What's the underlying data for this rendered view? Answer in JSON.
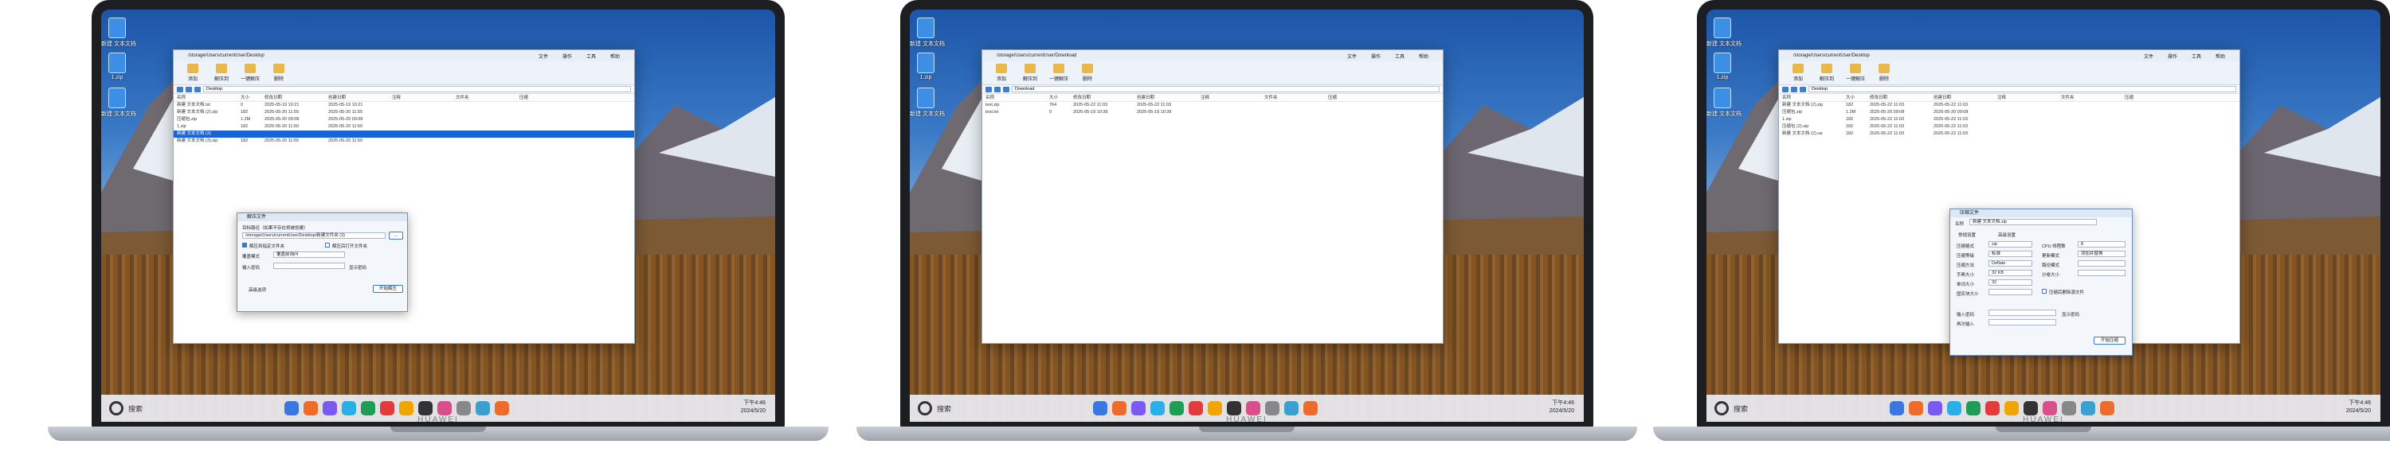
{
  "brand": "HUAWEI",
  "taskbar": {
    "search_label": "搜索",
    "time": "下午4:46",
    "date": "2024/5/20"
  },
  "desktop_icons": [
    {
      "label": "新建 文本文档"
    },
    {
      "label": "1.zip"
    },
    {
      "label": "新建 文本文档"
    }
  ],
  "ribbon": [
    "添加",
    "解压到",
    "一键解压",
    "删除"
  ],
  "menu": [
    "文件",
    "操作",
    "工具",
    "帮助"
  ],
  "columns": [
    "名称",
    "大小",
    "修改日期",
    "创建日期",
    "注释",
    "文件夹",
    "压缩"
  ],
  "screen1": {
    "path": "/storage/Users/currentUser/Desktop",
    "addr": "Desktop",
    "rows": [
      {
        "name": "新建 文本文档.txt",
        "size": "0",
        "mod": "2025-05-19 10:21",
        "cre": "2025-05-19 10:21"
      },
      {
        "name": "新建 文本文档 (2).zip",
        "size": "182",
        "mod": "2025-05-20 11:50",
        "cre": "2025-05-20 11:50"
      },
      {
        "name": "压缩包.zip",
        "size": "1.2M",
        "mod": "2025-05-20 09:08",
        "cre": "2025-05-20 09:08"
      },
      {
        "name": "1.zip",
        "size": "182",
        "mod": "2025-05-20 11:50",
        "cre": "2025-05-20 11:50"
      },
      {
        "name": "新建 文本文档 (3)",
        "size": "",
        "mod": "",
        "cre": "",
        "sel": true
      },
      {
        "name": "新建 文本文档 (3).zip",
        "size": "182",
        "mod": "2025-05-20 11:50",
        "cre": "2025-05-20 11:50"
      }
    ],
    "dialog": {
      "title": "解压文件",
      "target_label": "目标路径（如果不存在将被创建）",
      "target_value": "/storage/Users/currentUser/Desktop/新建文件夹 (3)",
      "opt1": "解压到指定文件夹",
      "opt2": "解压后打开文件夹",
      "overwrite_label": "覆盖模式",
      "overwrite_value": "覆盖前询问",
      "password_label": "输入密码",
      "show_password": "显示密码",
      "more": "高级选项",
      "ok": "开始解压"
    }
  },
  "screen2": {
    "path": "/storage/Users/currentUser/Download",
    "addr": "Download",
    "rows": [
      {
        "name": "test.zip",
        "size": "764",
        "mod": "2025-05-22 11:03",
        "cre": "2025-05-22 11:03"
      },
      {
        "name": "test.txt",
        "size": "0",
        "mod": "2025-05-19 10:39",
        "cre": "2025-05-19 10:39"
      }
    ]
  },
  "screen3": {
    "path": "/storage/Users/currentUser/Desktop",
    "addr": "Desktop",
    "rows": [
      {
        "name": "新建 文本文档 (2).zip",
        "size": "182",
        "mod": "2025-05-22 11:03",
        "cre": "2025-05-22 11:03"
      },
      {
        "name": "压缩包.zip",
        "size": "1.2M",
        "mod": "2025-05-20 09:08",
        "cre": "2025-05-20 09:08"
      },
      {
        "name": "1.zip",
        "size": "182",
        "mod": "2025-05-22 11:03",
        "cre": "2025-05-22 11:03"
      },
      {
        "name": "压缩包 (2).zip",
        "size": "182",
        "mod": "2025-05-22 11:03",
        "cre": "2025-05-22 11:03"
      },
      {
        "name": "新建 文本文档 (2).rar",
        "size": "182",
        "mod": "2025-05-22 11:03",
        "cre": "2025-05-22 11:03"
      }
    ],
    "dialog": {
      "title": "压缩文件",
      "name_label": "名称",
      "name_value": "新建 文本文档.zip",
      "tab1": "常规设置",
      "tab2": "高级设置",
      "format_label": "压缩格式",
      "format_value": "zip",
      "level_label": "压缩等级",
      "level_value": "标准",
      "method_label": "压缩方法",
      "method_value": "Deflate",
      "dict_label": "字典大小",
      "dict_value": "32 KB",
      "word_label": "单词大小",
      "word_value": "32",
      "solid_label": "固实块大小",
      "cpu_label": "CPU 线程数",
      "cpu_value": "8",
      "update_label": "更新模式",
      "update_value": "添加并替换",
      "path_label": "路径模式",
      "split_label": "分卷大小",
      "delete_after": "压缩后删除源文件",
      "password_label": "输入密码",
      "confirm_label": "再次输入",
      "show_password": "显示密码",
      "ok": "开始压缩"
    }
  }
}
